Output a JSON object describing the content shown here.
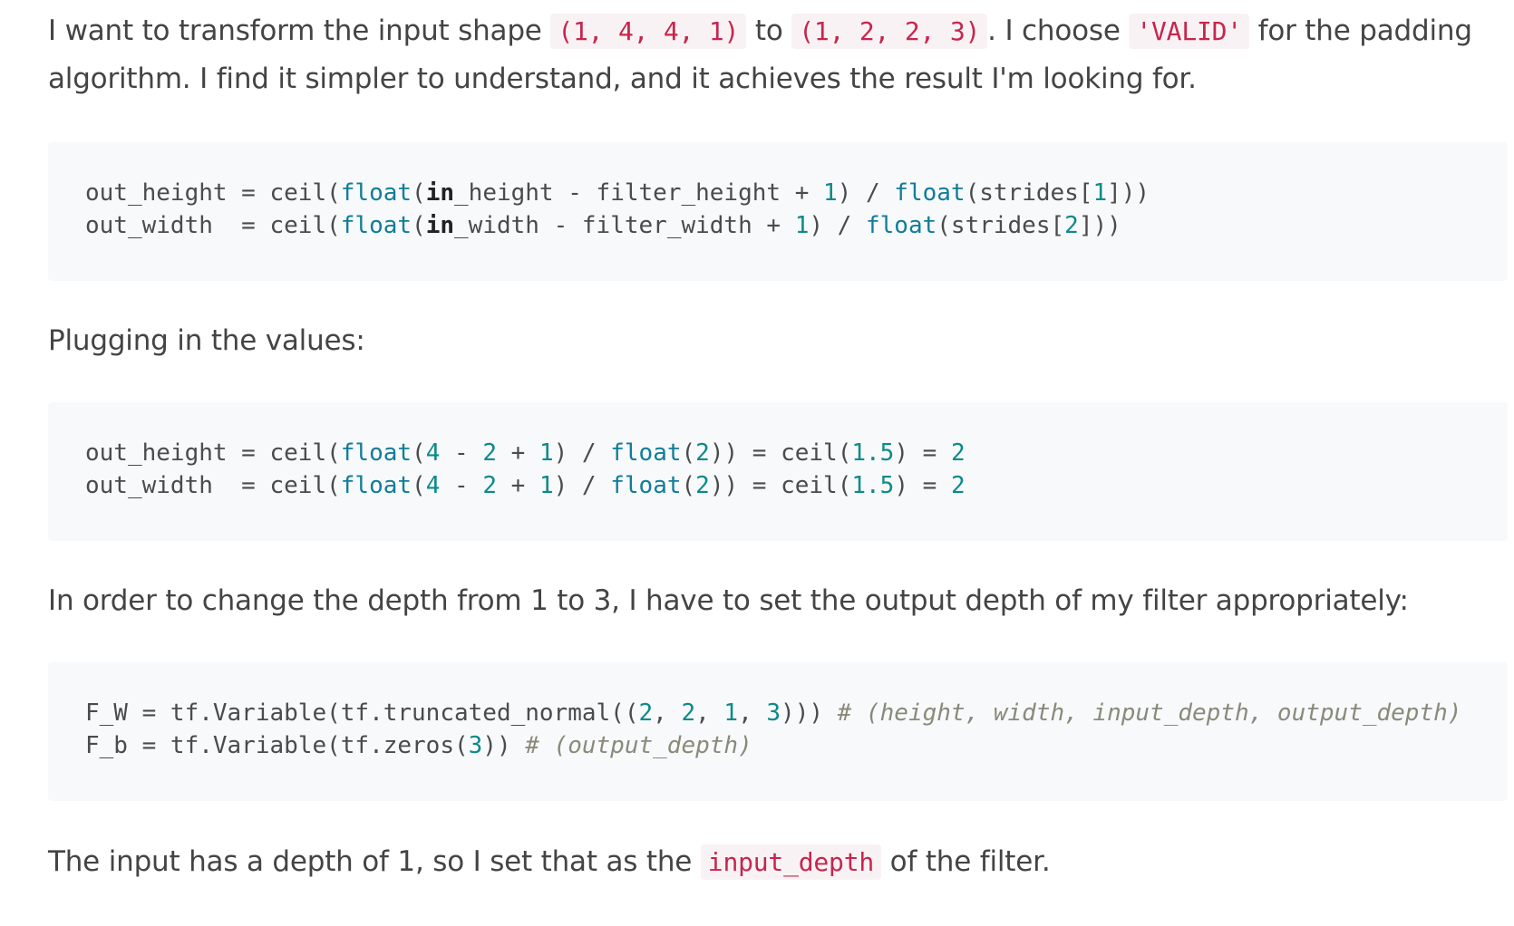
{
  "p1": {
    "t1": "I want to transform the input shape ",
    "c1": "(1, 4, 4, 1)",
    "t2": " to ",
    "c2": "(1, 2, 2, 3)",
    "t3": ". I choose ",
    "c3": "'VALID'",
    "t4": " for the padding",
    "line2": "algorithm. I find it simpler to understand, and it achieves the result I'm looking for."
  },
  "code1": {
    "l1": {
      "a": "out_height = ceil(",
      "b": "float",
      "c": "(",
      "d": "in",
      "e": "_height - filter_height + ",
      "f": "1",
      "g": ") / ",
      "h": "float",
      "i": "(strides[",
      "j": "1",
      "k": "]))"
    },
    "l2": {
      "a": "out_width  = ceil(",
      "b": "float",
      "c": "(",
      "d": "in",
      "e": "_width - filter_width + ",
      "f": "1",
      "g": ") / ",
      "h": "float",
      "i": "(strides[",
      "j": "2",
      "k": "]))"
    }
  },
  "p2": "Plugging in the values:",
  "code2": {
    "l1": {
      "a": "out_height = ceil(",
      "b": "float",
      "c": "(",
      "d": "4",
      "e": " - ",
      "f": "2",
      "g": " + ",
      "h": "1",
      "i": ") / ",
      "j": "float",
      "k": "(",
      "l": "2",
      "m": ")) = ceil(",
      "n": "1.5",
      "o": ") = ",
      "p": "2"
    },
    "l2": {
      "a": "out_width  = ceil(",
      "b": "float",
      "c": "(",
      "d": "4",
      "e": " - ",
      "f": "2",
      "g": " + ",
      "h": "1",
      "i": ") / ",
      "j": "float",
      "k": "(",
      "l": "2",
      "m": ")) = ceil(",
      "n": "1.5",
      "o": ") = ",
      "p": "2"
    }
  },
  "p3": "In order to change the depth from 1 to 3, I have to set the output depth of my filter appropriately:",
  "code3": {
    "l1": {
      "a": "F_W = tf.Variable(tf.truncated_normal((",
      "b": "2",
      "c": ", ",
      "d": "2",
      "e": ", ",
      "f": "1",
      "g": ", ",
      "h": "3",
      "i": "))) ",
      "j": "# (height, width, input_depth, output_depth)"
    },
    "l2": {
      "a": "F_b = tf.Variable(tf.zeros(",
      "b": "3",
      "c": ")) ",
      "d": "# (output_depth)"
    }
  },
  "p4": {
    "t1": "The input has a depth of 1, so I set that as the ",
    "c1": "input_depth",
    "t2": " of the filter."
  }
}
